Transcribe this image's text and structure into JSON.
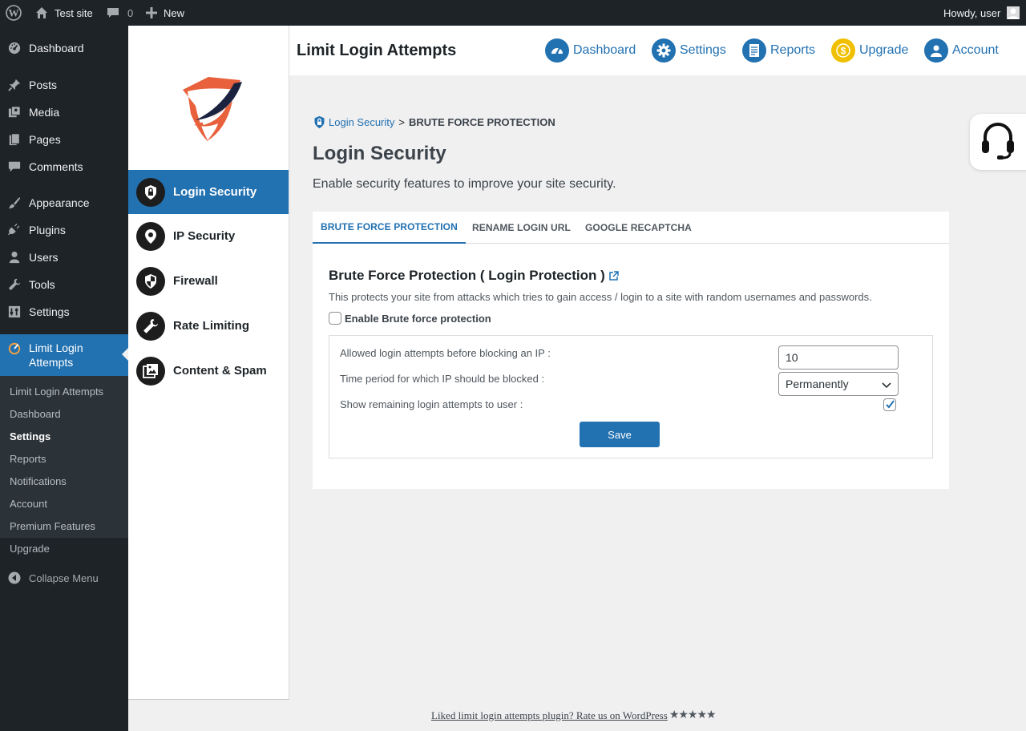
{
  "admin_bar": {
    "site_name": "Test site",
    "comments_count": "0",
    "new_label": "New",
    "greeting": "Howdy, user"
  },
  "admin_menu": {
    "items": [
      {
        "label": "Dashboard",
        "icon": "dashboard-icon"
      },
      {
        "label": "Posts",
        "icon": "pin-icon"
      },
      {
        "label": "Media",
        "icon": "media-icon"
      },
      {
        "label": "Pages",
        "icon": "pages-icon"
      },
      {
        "label": "Comments",
        "icon": "comment-icon"
      },
      {
        "label": "Appearance",
        "icon": "brush-icon"
      },
      {
        "label": "Plugins",
        "icon": "plug-icon"
      },
      {
        "label": "Users",
        "icon": "user-icon"
      },
      {
        "label": "Tools",
        "icon": "wrench-icon"
      },
      {
        "label": "Settings",
        "icon": "settings-icon"
      }
    ],
    "current": {
      "line1": "Limit Login",
      "line2": "Attempts"
    },
    "submenu": [
      "Limit Login Attempts",
      "Dashboard",
      "Settings",
      "Reports",
      "Notifications",
      "Account",
      "Premium Features",
      "Upgrade"
    ],
    "submenu_active": "Settings",
    "collapse_label": "Collapse Menu"
  },
  "plugin_nav": {
    "items": [
      {
        "label": "Login Security",
        "icon": "lock-shield-icon",
        "active": true
      },
      {
        "label": "IP Security",
        "icon": "location-pin-icon"
      },
      {
        "label": "Firewall",
        "icon": "shield-icon"
      },
      {
        "label": "Rate Limiting",
        "icon": "wrench-icon"
      },
      {
        "label": "Content & Spam",
        "icon": "images-icon"
      }
    ]
  },
  "header": {
    "title": "Limit Login Attempts",
    "nav": [
      {
        "label": "Dashboard",
        "icon": "speedometer-icon"
      },
      {
        "label": "Settings",
        "icon": "gear-icon"
      },
      {
        "label": "Reports",
        "icon": "report-icon"
      },
      {
        "label": "Upgrade",
        "icon": "dollar-icon"
      },
      {
        "label": "Account",
        "icon": "account-icon"
      }
    ]
  },
  "breadcrumb": {
    "link": "Login Security",
    "separator": ">",
    "current": "BRUTE FORCE PROTECTION"
  },
  "page": {
    "title": "Login Security",
    "description": "Enable security features to improve your site security."
  },
  "tabs": [
    "BRUTE FORCE PROTECTION",
    "RENAME LOGIN URL",
    "GOOGLE RECAPTCHA"
  ],
  "section": {
    "title": "Brute Force Protection ( Login Protection )",
    "description": "This protects your site from attacks which tries to gain access / login to a site with random usernames and passwords.",
    "enable_label": "Enable Brute force protection",
    "enable_checked": false,
    "attempts_label": "Allowed login attempts before blocking an IP :",
    "attempts_value": "10",
    "period_label": "Time period for which IP should be blocked :",
    "period_value": "Permanently",
    "remaining_label": "Show remaining login attempts to user :",
    "remaining_checked": true,
    "save_label": "Save"
  },
  "footer": {
    "text": "Liked limit login attempts plugin? Rate us on WordPress",
    "stars": "★★★★★"
  },
  "colors": {
    "accent": "#2271b1",
    "admin_bg": "#1d2327",
    "upgrade_gold": "#f0c000",
    "logo_orange": "#e8603c",
    "logo_navy": "#1a2240"
  }
}
